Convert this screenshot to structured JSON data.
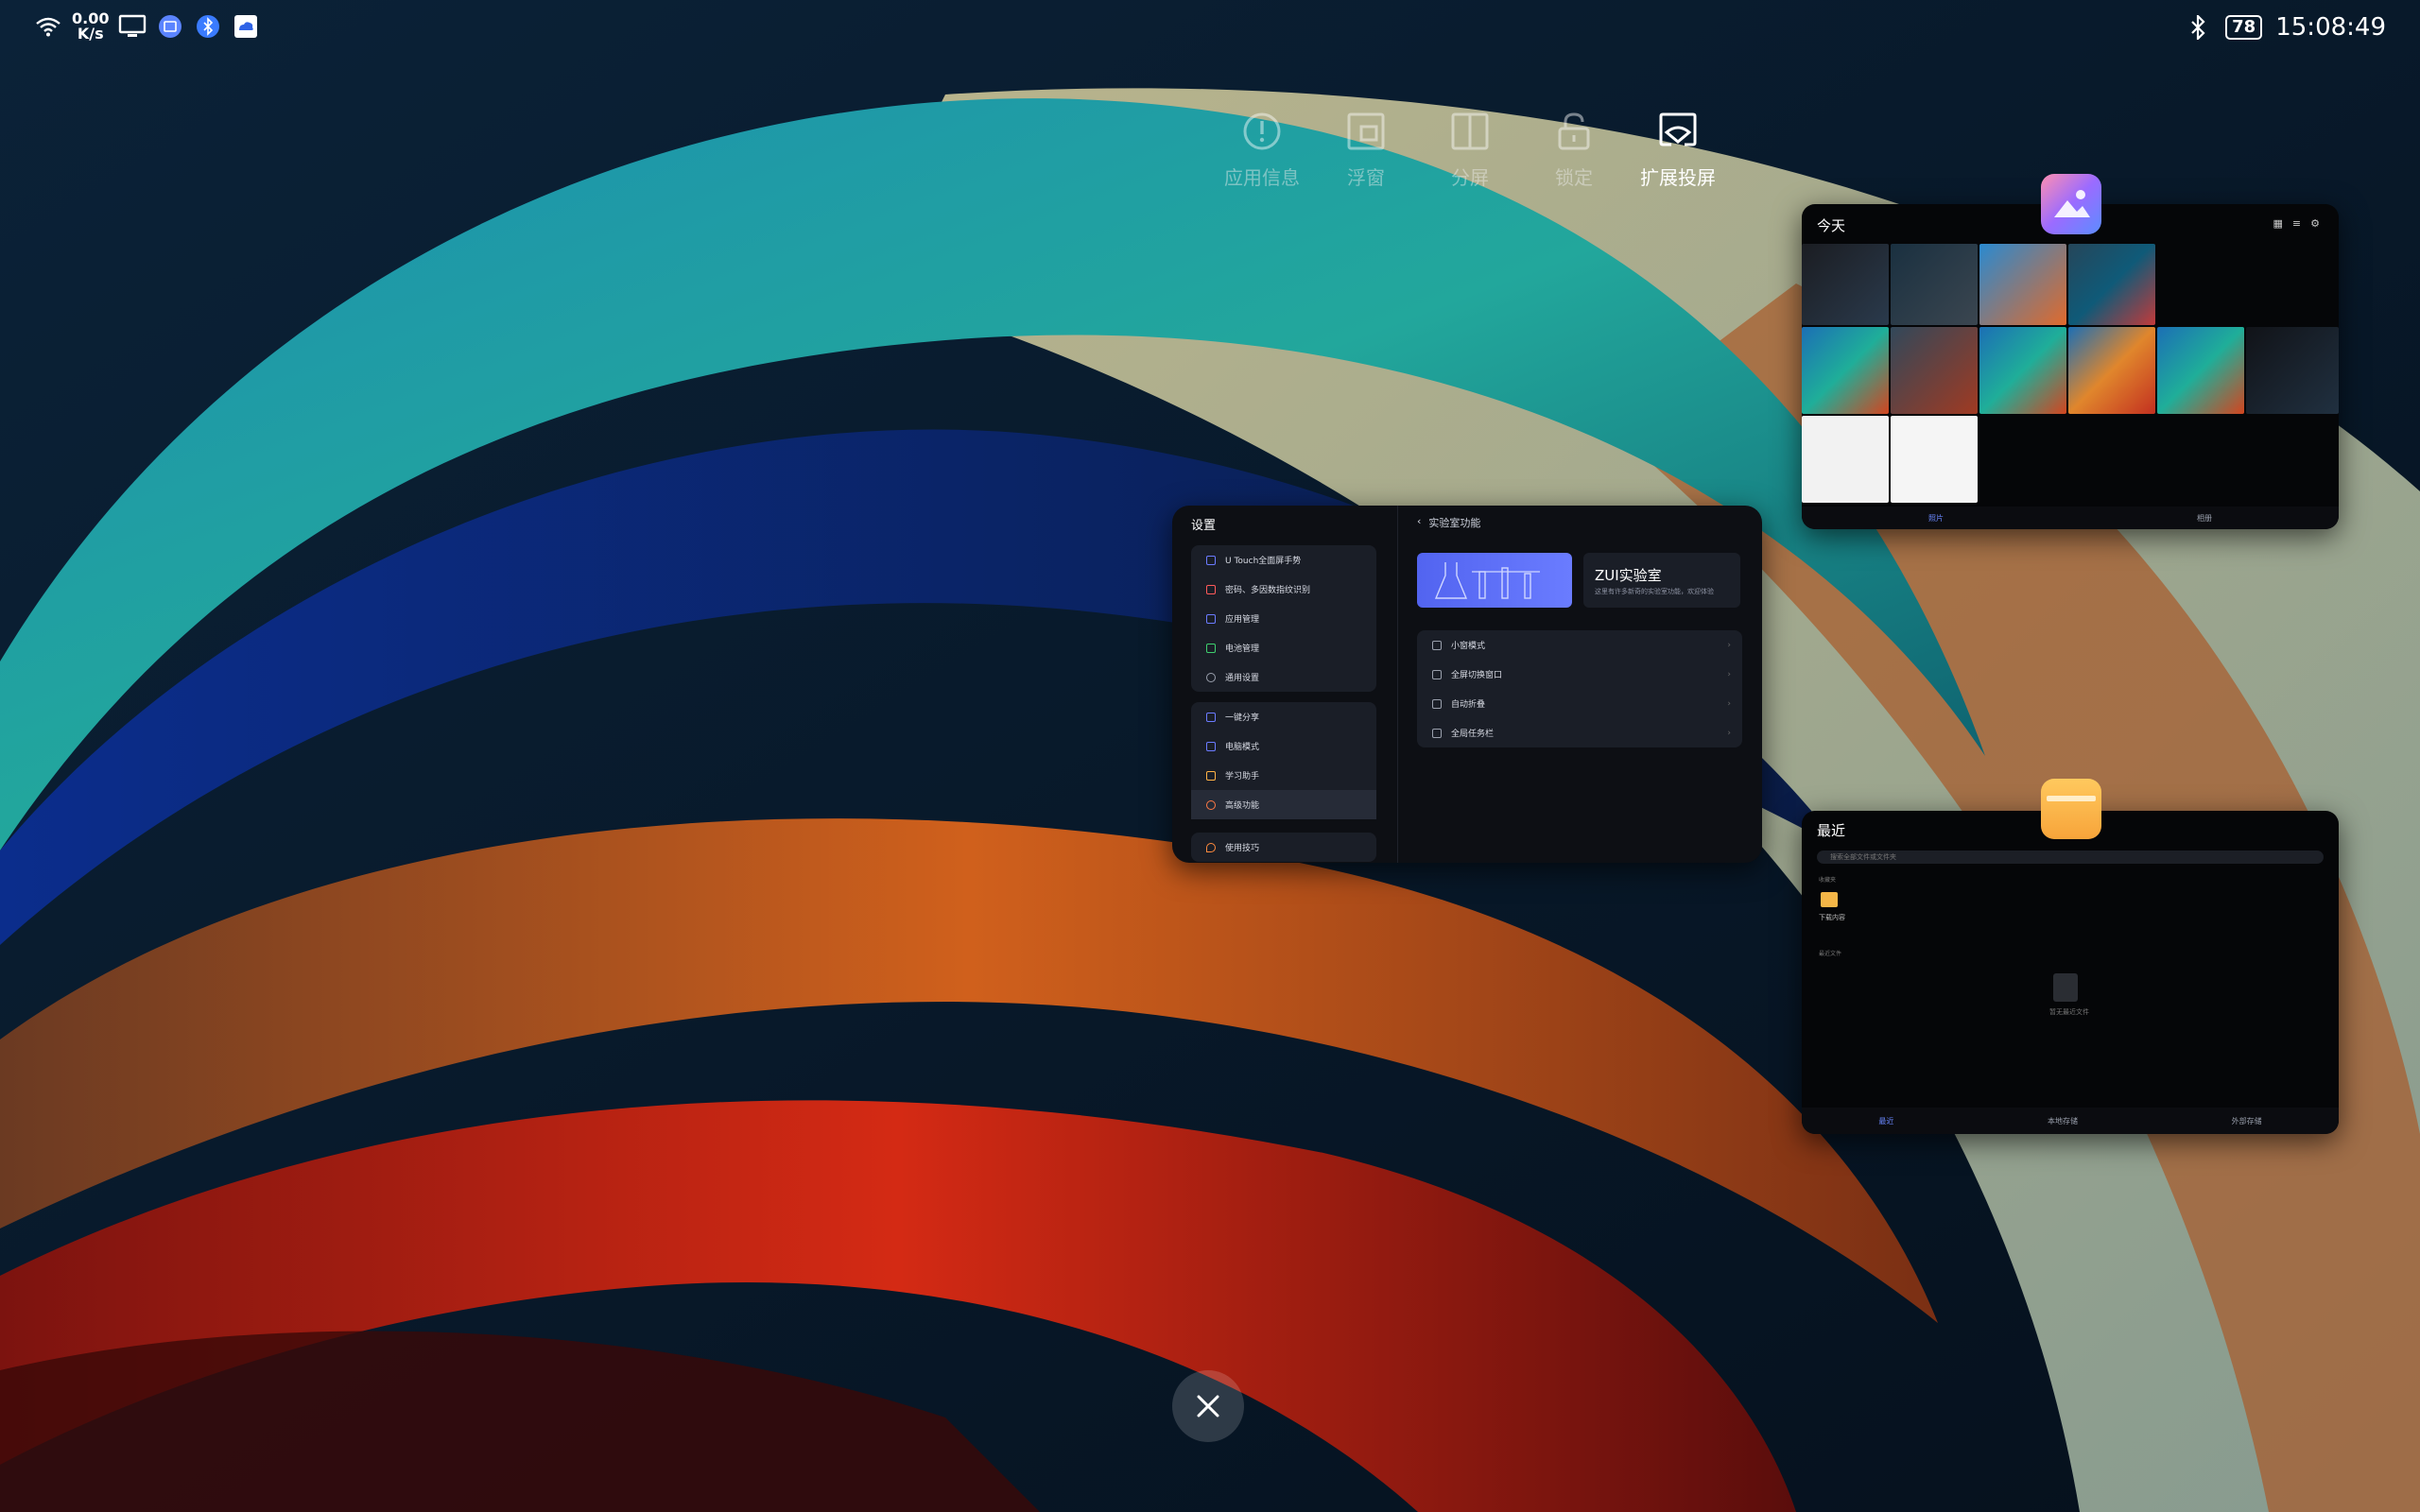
{
  "status_bar": {
    "net_speed_value": "0.00",
    "net_speed_unit": "K/s",
    "battery": "78",
    "time": "15:08:49"
  },
  "actions": [
    {
      "label": "应用信息",
      "icon": "info-icon"
    },
    {
      "label": "浮窗",
      "icon": "float-window-icon"
    },
    {
      "label": "分屏",
      "icon": "split-screen-icon"
    },
    {
      "label": "锁定",
      "icon": "lock-icon"
    },
    {
      "label": "扩展投屏",
      "icon": "cast-screen-icon"
    }
  ],
  "settings": {
    "title": "设置",
    "page_header": "实验室功能",
    "banner_title": "ZUI实验室",
    "banner_sub": "这里有许多新奇的实验室功能，欢迎体验",
    "group1": [
      "U Touch全面屏手势",
      "密码、多因数指纹识别",
      "应用管理",
      "电池管理",
      "通用设置"
    ],
    "group2": [
      "一键分享",
      "电脑模式",
      "学习助手",
      "高级功能"
    ],
    "group3": [
      "使用技巧"
    ],
    "lab_items": [
      "小窗模式",
      "全屏切换窗口",
      "自动折叠",
      "全局任务栏"
    ]
  },
  "gallery": {
    "title": "今天",
    "nav": [
      "照片",
      "相册"
    ]
  },
  "files": {
    "title": "最近",
    "search_placeholder": "搜索全部文件或文件夹",
    "section_folders": "收藏夹",
    "folder_label": "下载内容",
    "section_recent": "最近文件",
    "empty_label": "暂无最近文件",
    "nav": [
      "最近",
      "本地存储",
      "外部存储"
    ]
  },
  "colors": {
    "accent": "#6a88ff",
    "lab_banner": "#5264f0",
    "folder": "#f5b647"
  }
}
